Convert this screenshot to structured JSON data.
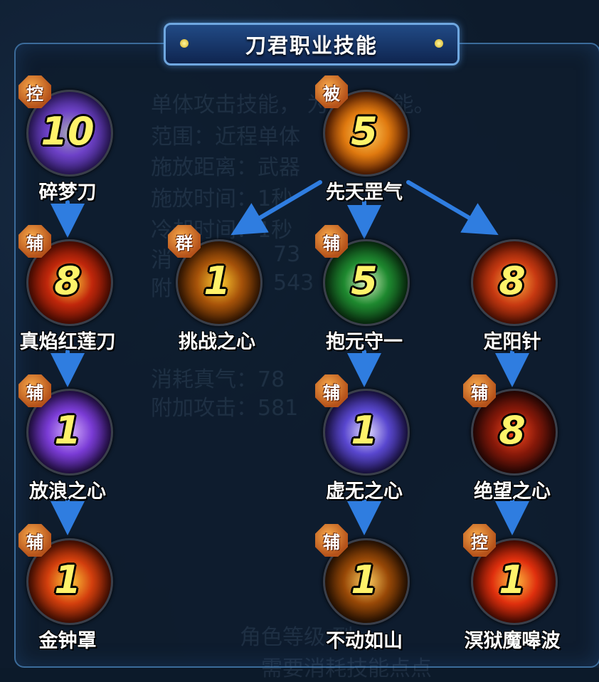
{
  "title": "刀君职业技能",
  "background_text": [
    "单体攻击技能，    为基本技能。",
    "范围：近程单体",
    "施放距离：武器",
    "施放时间：1秒",
    "冷却时间：1秒",
    "消",
    "73",
    "附",
    "543",
    "消耗真气：78",
    "附加攻击：581",
    "角色等级        到",
    "需要消耗技能点点"
  ],
  "colors": {
    "panel_border": "#3b6b9a",
    "title_plate": "#214a85",
    "level_text": "#fff36a",
    "badge": "#d7702a",
    "arrow": "#2f7de0"
  },
  "skills": [
    {
      "name": "碎梦刀",
      "level": "10",
      "badge": "控",
      "icon": "shattered-dream-blade-icon",
      "palette": [
        "#2a1860",
        "#6e42c8",
        "#a7a7b8"
      ]
    },
    {
      "name": "真焰红莲刀",
      "level": "8",
      "badge": "辅",
      "icon": "red-lotus-blade-icon",
      "palette": [
        "#4a0a00",
        "#c2280c",
        "#ffd23a"
      ]
    },
    {
      "name": "放浪之心",
      "level": "1",
      "badge": "辅",
      "icon": "wandering-heart-icon",
      "palette": [
        "#1a0a3a",
        "#7b3cd6",
        "#d7b2ff"
      ]
    },
    {
      "name": "金钟罩",
      "level": "1",
      "badge": "辅",
      "icon": "golden-bell-shield-icon",
      "palette": [
        "#3a0800",
        "#d4400e",
        "#ffca3a"
      ]
    },
    {
      "name": "先天罡气",
      "level": "5",
      "badge": "被",
      "icon": "innate-qi-icon",
      "palette": [
        "#4a1000",
        "#e07a10",
        "#ffd060"
      ]
    },
    {
      "name": "挑战之心",
      "level": "1",
      "badge": "群",
      "icon": "challenge-heart-icon",
      "palette": [
        "#2a1000",
        "#a8540a",
        "#ffcc30"
      ]
    },
    {
      "name": "抱元守一",
      "level": "5",
      "badge": "辅",
      "icon": "embrace-origin-icon",
      "palette": [
        "#06240c",
        "#1f8a30",
        "#d8f0c0"
      ]
    },
    {
      "name": "定阳针",
      "level": "8",
      "badge": "",
      "icon": "sun-needle-icon",
      "palette": [
        "#4a0c00",
        "#c83a12",
        "#ffb040"
      ]
    },
    {
      "name": "虚无之心",
      "level": "1",
      "badge": "辅",
      "icon": "void-heart-icon",
      "palette": [
        "#140c3a",
        "#5a48d0",
        "#e6e0ff"
      ]
    },
    {
      "name": "绝望之心",
      "level": "8",
      "badge": "辅",
      "icon": "despair-heart-icon",
      "palette": [
        "#1a0404",
        "#8a1a0a",
        "#ff4a1e"
      ]
    },
    {
      "name": "不动如山",
      "level": "1",
      "badge": "辅",
      "icon": "immovable-mountain-icon",
      "palette": [
        "#1a0a00",
        "#9a4a08",
        "#ffd060"
      ]
    },
    {
      "name": "溟狱魔嗥波",
      "level": "1",
      "badge": "控",
      "icon": "underworld-howl-wave-icon",
      "palette": [
        "#3a0600",
        "#e0300e",
        "#ffc040"
      ]
    }
  ]
}
